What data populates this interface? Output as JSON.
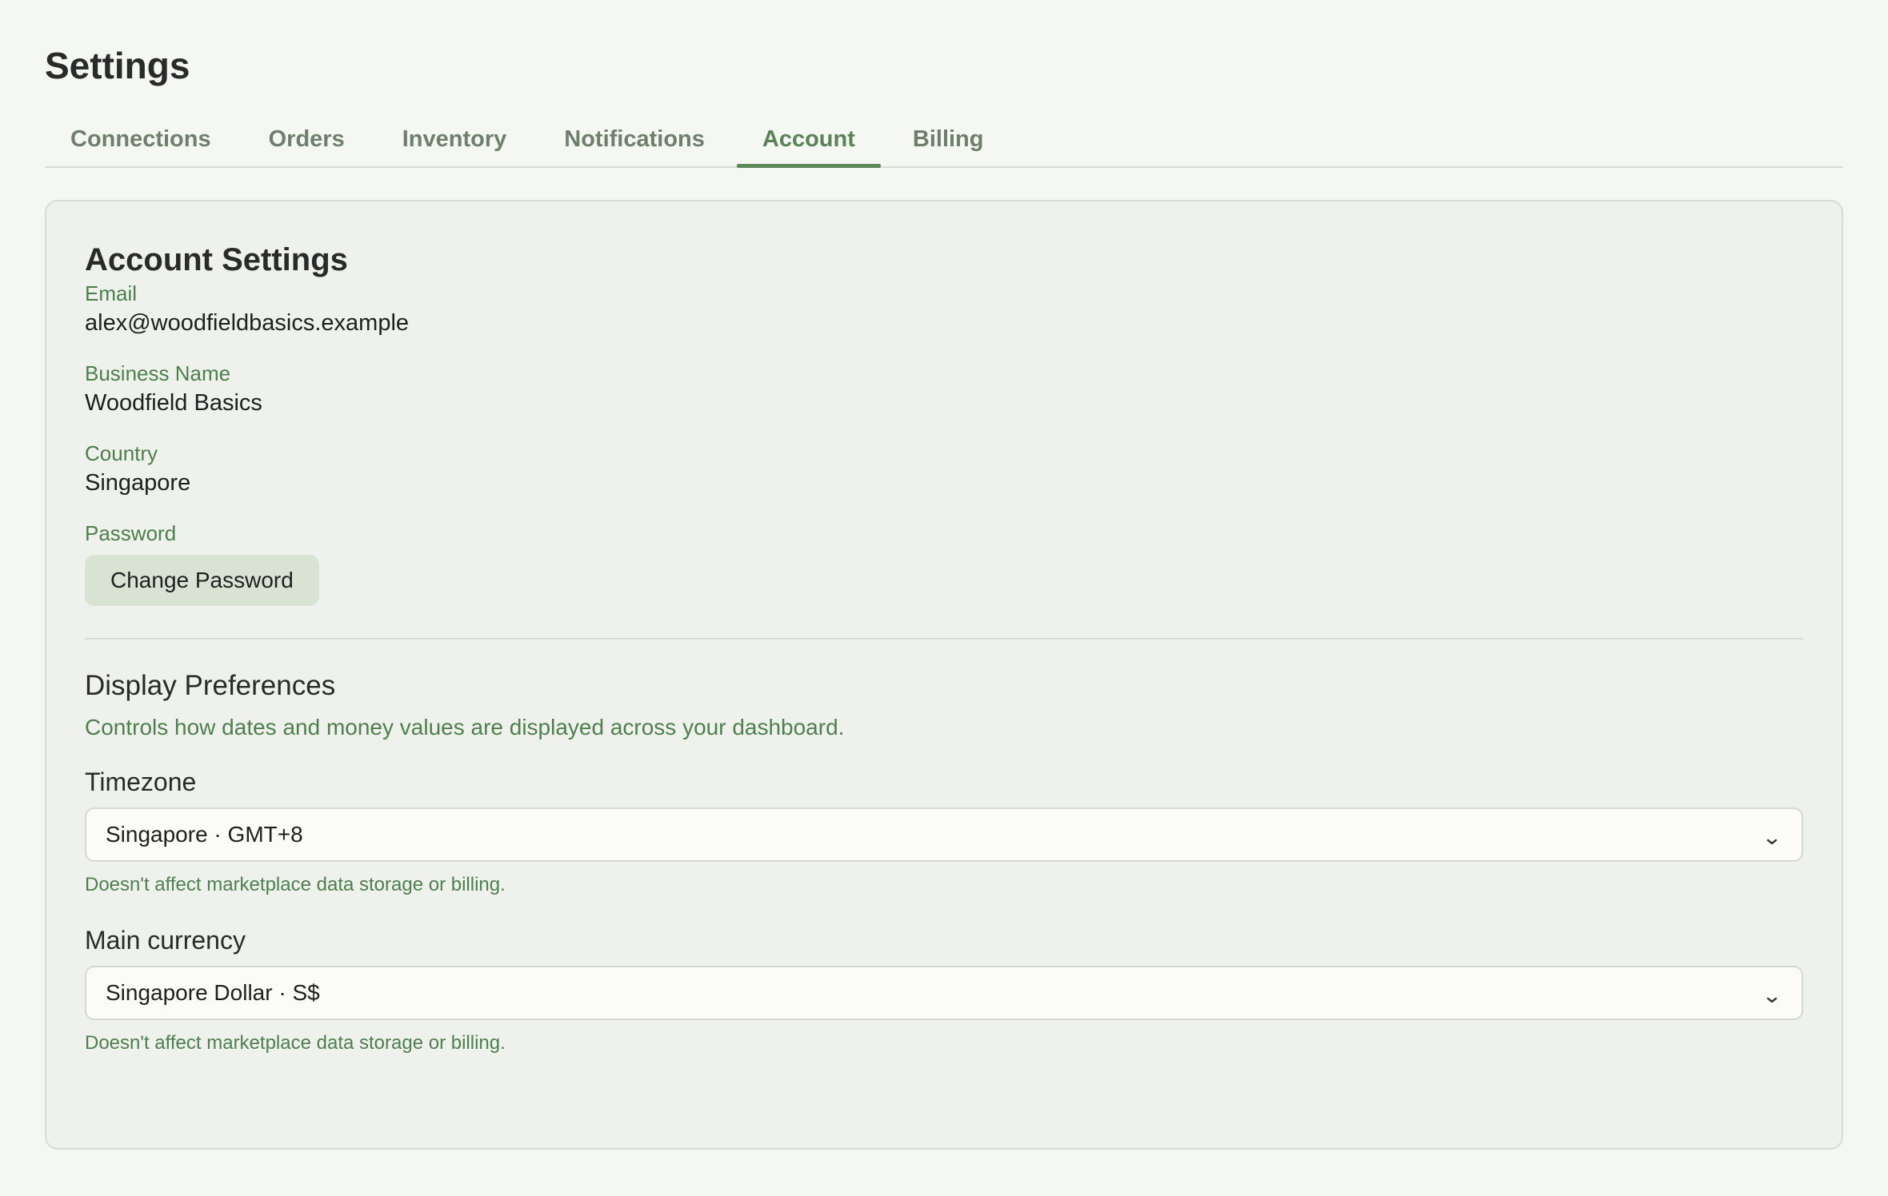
{
  "page": {
    "title": "Settings"
  },
  "tabs": [
    {
      "label": "Connections",
      "active": false
    },
    {
      "label": "Orders",
      "active": false
    },
    {
      "label": "Inventory",
      "active": false
    },
    {
      "label": "Notifications",
      "active": false
    },
    {
      "label": "Account",
      "active": true
    },
    {
      "label": "Billing",
      "active": false
    }
  ],
  "account": {
    "title": "Account Settings",
    "email": {
      "label": "Email",
      "value": "alex@woodfieldbasics.example"
    },
    "business_name": {
      "label": "Business Name",
      "value": "Woodfield Basics"
    },
    "country": {
      "label": "Country",
      "value": "Singapore"
    },
    "password": {
      "label": "Password",
      "button_label": "Change Password"
    }
  },
  "display_preferences": {
    "title": "Display Preferences",
    "description": "Controls how dates and money values are displayed across your dashboard.",
    "timezone": {
      "label": "Timezone",
      "selected": "Singapore · GMT+8",
      "hint": "Doesn't affect marketplace data storage or billing.",
      "chevron_icon": "chevron-down-icon"
    },
    "currency": {
      "label": "Main currency",
      "selected": "Singapore Dollar · S$",
      "hint": "Doesn't affect marketplace data storage or billing.",
      "chevron_icon": "chevron-down-icon"
    }
  },
  "colors": {
    "background": "#f5f7f3",
    "card": "#eff1ec",
    "accent": "#5b8a58",
    "label_green": "#4d7f4c",
    "button_bg": "#d9e3d3"
  }
}
